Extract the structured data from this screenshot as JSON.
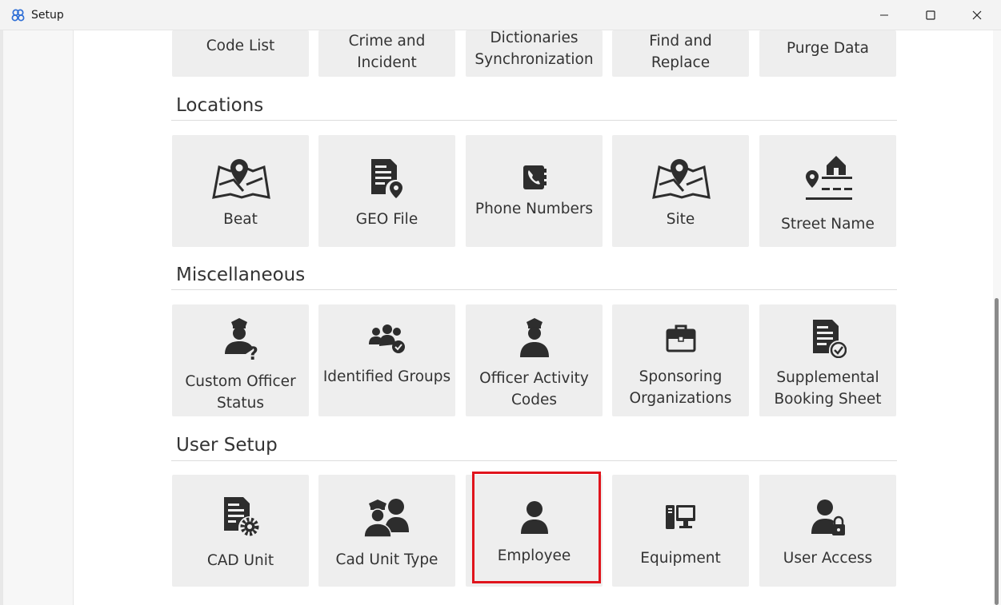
{
  "window": {
    "title": "Setup",
    "minimize_icon": "minimize-icon",
    "maximize_icon": "maximize-icon",
    "close_icon": "close-icon"
  },
  "top_row": [
    {
      "label": "Code List"
    },
    {
      "label": "Crime and Incident"
    },
    {
      "label": "Dictionaries Synchronization"
    },
    {
      "label": "Find and Replace"
    },
    {
      "label": "Purge Data"
    }
  ],
  "sections": {
    "locations": {
      "title": "Locations",
      "tiles": [
        {
          "label": "Beat",
          "icon": "map-pin-icon"
        },
        {
          "label": "GEO File",
          "icon": "geo-file-icon"
        },
        {
          "label": "Phone Numbers",
          "icon": "phone-book-icon"
        },
        {
          "label": "Site",
          "icon": "map-pin-icon"
        },
        {
          "label": "Street Name",
          "icon": "street-house-icon"
        }
      ]
    },
    "miscellaneous": {
      "title": "Miscellaneous",
      "tiles": [
        {
          "label": "Custom Officer Status",
          "icon": "officer-question-icon"
        },
        {
          "label": "Identified Groups",
          "icon": "group-check-icon"
        },
        {
          "label": "Officer Activity Codes",
          "icon": "officer-icon"
        },
        {
          "label": "Sponsoring Organizations",
          "icon": "briefcase-icon"
        },
        {
          "label": "Supplemental Booking Sheet",
          "icon": "document-check-icon"
        }
      ]
    },
    "user_setup": {
      "title": "User Setup",
      "tiles": [
        {
          "label": "CAD Unit",
          "icon": "document-gear-icon"
        },
        {
          "label": "Cad Unit Type",
          "icon": "officers-group-icon"
        },
        {
          "label": "Employee",
          "icon": "user-icon"
        },
        {
          "label": "Equipment",
          "icon": "computer-icon"
        },
        {
          "label": "User Access",
          "icon": "user-lock-icon"
        }
      ]
    }
  },
  "colors": {
    "tile_bg": "#eeeeee",
    "icon": "#2d2d2d",
    "highlight": "#e0141c"
  }
}
